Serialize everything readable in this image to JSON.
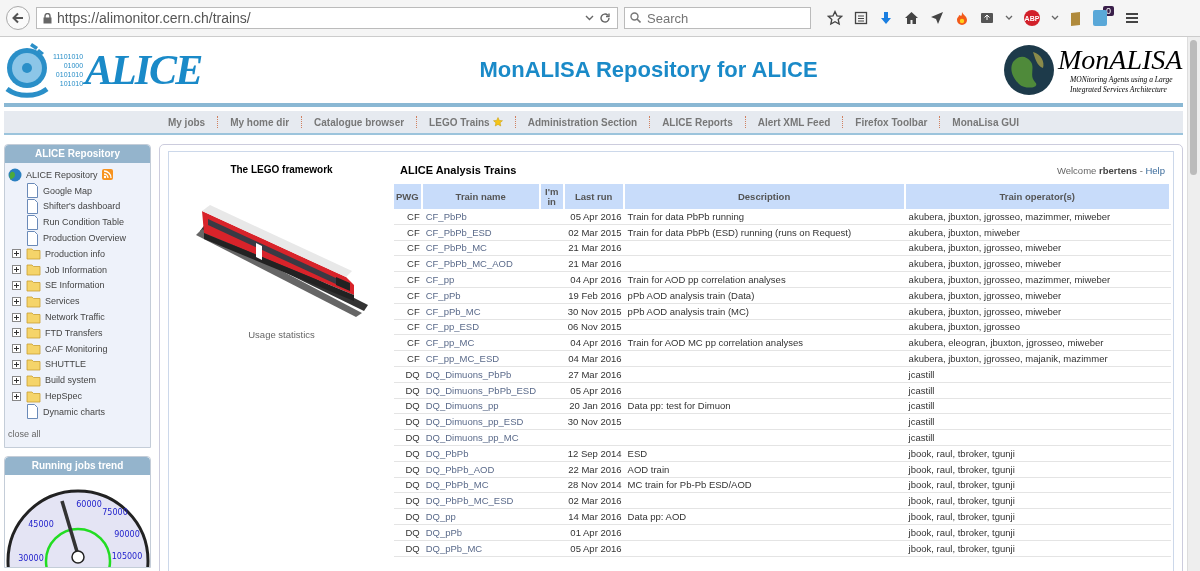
{
  "browser": {
    "url": "https://alimonitor.cern.ch/trains/",
    "search_placeholder": "Search",
    "adblock_label": "ABP",
    "badge_count": "0"
  },
  "header": {
    "alice_logo": {
      "word": "ALICE",
      "binary": [
        "11101010",
        "01000",
        "0101010",
        "101010"
      ]
    },
    "title": "MonALISA Repository for ALICE",
    "monalisa_logo": {
      "word": "MonALISA",
      "lines": [
        "MONitoring Agents using a Large",
        "Integrated Services Architecture"
      ]
    }
  },
  "nav": [
    {
      "label": "My jobs",
      "starred": false
    },
    {
      "label": "My home dir",
      "starred": false
    },
    {
      "label": "Catalogue browser",
      "starred": false
    },
    {
      "label": "LEGO Trains",
      "starred": true
    },
    {
      "label": "Administration Section",
      "starred": false
    },
    {
      "label": "ALICE Reports",
      "starred": false
    },
    {
      "label": "Alert XML Feed",
      "starred": false
    },
    {
      "label": "Firefox Toolbar",
      "starred": false
    },
    {
      "label": "MonaLisa GUI",
      "starred": false
    }
  ],
  "sidebar": {
    "title": "ALICE Repository",
    "tree": {
      "label": "ALICE Repository",
      "children": [
        {
          "label": "Google Map",
          "kind": "page"
        },
        {
          "label": "Shifter's dashboard",
          "kind": "page"
        },
        {
          "label": "Run Condition Table",
          "kind": "page"
        },
        {
          "label": "Production Overview",
          "kind": "page"
        },
        {
          "label": "Production info",
          "kind": "folder",
          "expanded": false
        },
        {
          "label": "Job Information",
          "kind": "folder",
          "expanded": false
        },
        {
          "label": "SE Information",
          "kind": "folder",
          "expanded": false
        },
        {
          "label": "Services",
          "kind": "folder",
          "expanded": false
        },
        {
          "label": "Network Traffic",
          "kind": "folder",
          "expanded": false
        },
        {
          "label": "FTD Transfers",
          "kind": "folder",
          "expanded": false
        },
        {
          "label": "CAF Monitoring",
          "kind": "folder",
          "expanded": false
        },
        {
          "label": "SHUTTLE",
          "kind": "folder",
          "expanded": false
        },
        {
          "label": "Build system",
          "kind": "folder",
          "expanded": false
        },
        {
          "label": "HepSpec",
          "kind": "folder",
          "expanded": false
        },
        {
          "label": "Dynamic charts",
          "kind": "page"
        }
      ]
    },
    "close_all": "close all"
  },
  "trend": {
    "title": "Running jobs trend",
    "gauge_labels": [
      "30000",
      "45000",
      "60000",
      "75000",
      "90000",
      "105000"
    ]
  },
  "lego": {
    "title": "The LEGO framework",
    "link": "Usage statistics"
  },
  "trains": {
    "title": "ALICE Analysis Trains",
    "welcome": "Welcome",
    "user": "rbertens",
    "separator": "-",
    "help": "Help",
    "columns": [
      "PWG",
      "Train name",
      "I'm in",
      "Last run",
      "Description",
      "Train operator(s)"
    ],
    "rows": [
      [
        "CF",
        "CF_PbPb",
        "",
        "05 Apr 2016",
        "Train for data PbPb running",
        "akubera, jbuxton, jgrosseo, mazimmer, miweber"
      ],
      [
        "CF",
        "CF_PbPb_ESD",
        "",
        "02 Mar 2015",
        "Train for data PbPb (ESD) running (runs on Request)",
        "akubera, jbuxton, miweber"
      ],
      [
        "CF",
        "CF_PbPb_MC",
        "",
        "21 Mar 2016",
        "",
        "akubera, jbuxton, jgrosseo, miweber"
      ],
      [
        "CF",
        "CF_PbPb_MC_AOD",
        "",
        "21 Mar 2016",
        "",
        "akubera, jbuxton, jgrosseo, miweber"
      ],
      [
        "CF",
        "CF_pp",
        "",
        "04 Apr 2016",
        "Train for AOD pp correlation analyses",
        "akubera, jbuxton, jgrosseo, mazimmer, miweber"
      ],
      [
        "CF",
        "CF_pPb",
        "",
        "19 Feb 2016",
        "pPb AOD analysis train (Data)",
        "akubera, jbuxton, jgrosseo, miweber"
      ],
      [
        "CF",
        "CF_pPb_MC",
        "",
        "30 Nov 2015",
        "pPb AOD analysis train (MC)",
        "akubera, jbuxton, jgrosseo, miweber"
      ],
      [
        "CF",
        "CF_pp_ESD",
        "",
        "06 Nov 2015",
        "",
        "akubera, jbuxton, jgrosseo"
      ],
      [
        "CF",
        "CF_pp_MC",
        "",
        "04 Apr 2016",
        "Train for AOD MC pp correlation analyses",
        "akubera, eleogran, jbuxton, jgrosseo, miweber"
      ],
      [
        "CF",
        "CF_pp_MC_ESD",
        "",
        "04 Mar 2016",
        "",
        "akubera, jbuxton, jgrosseo, majanik, mazimmer"
      ],
      [
        "DQ",
        "DQ_Dimuons_PbPb",
        "",
        "27 Mar 2016",
        "",
        "jcastill"
      ],
      [
        "DQ",
        "DQ_Dimuons_PbPb_ESD",
        "",
        "05 Apr 2016",
        "",
        "jcastill"
      ],
      [
        "DQ",
        "DQ_Dimuons_pp",
        "",
        "20 Jan 2016",
        "Data pp: test for Dimuon",
        "jcastill"
      ],
      [
        "DQ",
        "DQ_Dimuons_pp_ESD",
        "",
        "30 Nov 2015",
        "",
        "jcastill"
      ],
      [
        "DQ",
        "DQ_Dimuons_pp_MC",
        "",
        "",
        "",
        "jcastill"
      ],
      [
        "DQ",
        "DQ_PbPb",
        "",
        "12 Sep 2014",
        "ESD",
        "jbook, raul, tbroker, tgunji"
      ],
      [
        "DQ",
        "DQ_PbPb_AOD",
        "",
        "22 Mar 2016",
        "AOD train",
        "jbook, raul, tbroker, tgunji"
      ],
      [
        "DQ",
        "DQ_PbPb_MC",
        "",
        "28 Nov 2014",
        "MC train for Pb-Pb ESD/AOD",
        "jbook, raul, tbroker, tgunji"
      ],
      [
        "DQ",
        "DQ_PbPb_MC_ESD",
        "",
        "02 Mar 2016",
        "",
        "jbook, raul, tbroker, tgunji"
      ],
      [
        "DQ",
        "DQ_pp",
        "",
        "14 Mar 2016",
        "Data pp: AOD",
        "jbook, raul, tbroker, tgunji"
      ],
      [
        "DQ",
        "DQ_pPb",
        "",
        "01 Apr 2016",
        "",
        "jbook, raul, tbroker, tgunji"
      ],
      [
        "DQ",
        "DQ_pPb_MC",
        "",
        "05 Apr 2016",
        "",
        "jbook, raul, tbroker, tgunji"
      ]
    ]
  }
}
